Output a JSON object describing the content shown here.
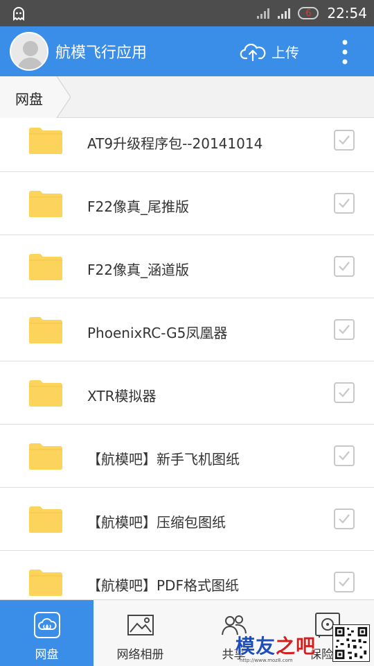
{
  "status_bar": {
    "battery_level": "6",
    "time": "22:54"
  },
  "header": {
    "app_title": "航模飞行应用",
    "upload_label": "上传"
  },
  "breadcrumb": {
    "current": "网盘"
  },
  "files": [
    {
      "name": "AT9升级程序包--20141014",
      "type": "folder"
    },
    {
      "name": "F22像真_尾推版",
      "type": "folder"
    },
    {
      "name": "F22像真_涵道版",
      "type": "folder"
    },
    {
      "name": "PhoenixRC-G5凤凰器",
      "type": "folder"
    },
    {
      "name": "XTR模拟器",
      "type": "folder"
    },
    {
      "name": "【航模吧】新手飞机图纸",
      "type": "folder"
    },
    {
      "name": "【航模吧】压缩包图纸",
      "type": "folder"
    },
    {
      "name": "【航模吧】PDF格式图纸",
      "type": "folder"
    }
  ],
  "bottom_nav": {
    "items": [
      {
        "label": "网盘",
        "icon": "cloud-drive-icon",
        "active": true
      },
      {
        "label": "网络相册",
        "icon": "photo-album-icon",
        "active": false
      },
      {
        "label": "共享",
        "icon": "share-users-icon",
        "active": false
      },
      {
        "label": "保险箱",
        "icon": "safe-icon",
        "active": false
      }
    ]
  },
  "watermark": {
    "brand_part1": "模友",
    "brand_part2": "之吧",
    "url": "http://www.moz8.com"
  },
  "colors": {
    "accent": "#3b8ee8",
    "status_bar": "#4d4d4d",
    "folder": "#fcd45c",
    "battery_text": "#e53935"
  }
}
